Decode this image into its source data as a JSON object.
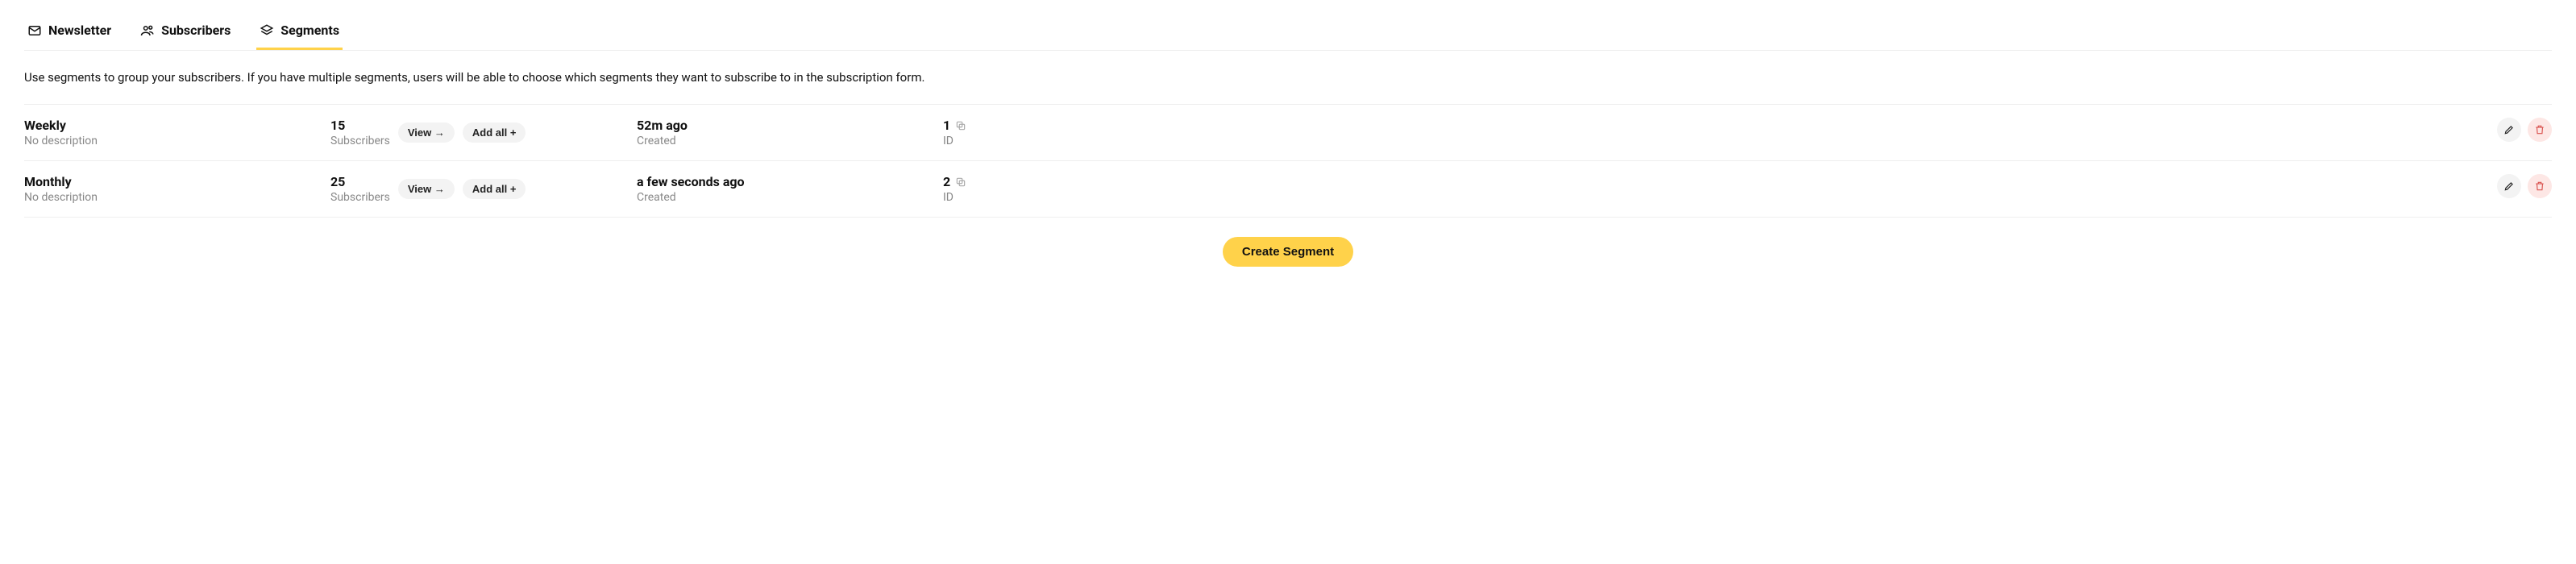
{
  "tabs": [
    {
      "label": "Newsletter",
      "icon": "mail"
    },
    {
      "label": "Subscribers",
      "icon": "people"
    },
    {
      "label": "Segments",
      "icon": "layers",
      "active": true
    }
  ],
  "help_text": "Use segments to group your subscribers. If you have multiple segments, users will be able to choose which segments they want to subscribe to in the subscription form.",
  "labels": {
    "no_description": "No description",
    "subscribers": "Subscribers",
    "view": "View →",
    "add_all": "Add all +",
    "created": "Created",
    "id": "ID",
    "create_segment": "Create Segment"
  },
  "segments": [
    {
      "name": "Weekly",
      "description": null,
      "subscribers": 15,
      "created": "52m ago",
      "id": 1
    },
    {
      "name": "Monthly",
      "description": null,
      "subscribers": 25,
      "created": "a few seconds ago",
      "id": 2
    }
  ]
}
